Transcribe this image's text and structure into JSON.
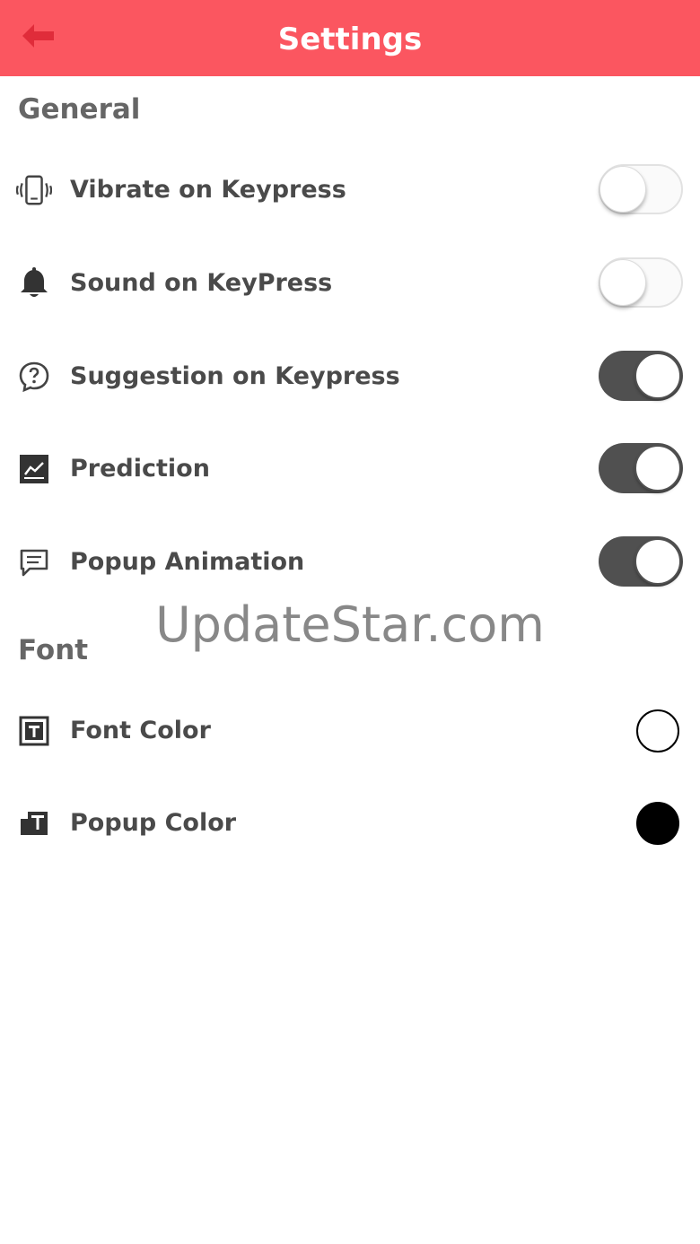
{
  "appbar": {
    "title": "Settings",
    "color": "#fb5660"
  },
  "sections": {
    "general": {
      "title": "General"
    },
    "font": {
      "title": "Font"
    }
  },
  "settings": {
    "vibrate": {
      "label": "Vibrate on Keypress",
      "icon": "vibration-icon",
      "enabled": false
    },
    "sound": {
      "label": "Sound on KeyPress",
      "icon": "bell-icon",
      "enabled": false
    },
    "suggestion": {
      "label": "Suggestion on Keypress",
      "icon": "question-bubble-icon",
      "enabled": true
    },
    "prediction": {
      "label": "Prediction",
      "icon": "chart-icon",
      "enabled": true
    },
    "popup_animation": {
      "label": "Popup Animation",
      "icon": "message-icon",
      "enabled": true
    }
  },
  "font_settings": {
    "font_color": {
      "label": "Font Color",
      "icon": "text-box-icon",
      "color": "#ffffff"
    },
    "popup_color": {
      "label": "Popup Color",
      "icon": "popup-text-icon",
      "color": "#000000"
    }
  },
  "watermark": "UpdateStar.com",
  "colors": {
    "toggle_on": "#505050",
    "toggle_off": "#fafafa"
  }
}
